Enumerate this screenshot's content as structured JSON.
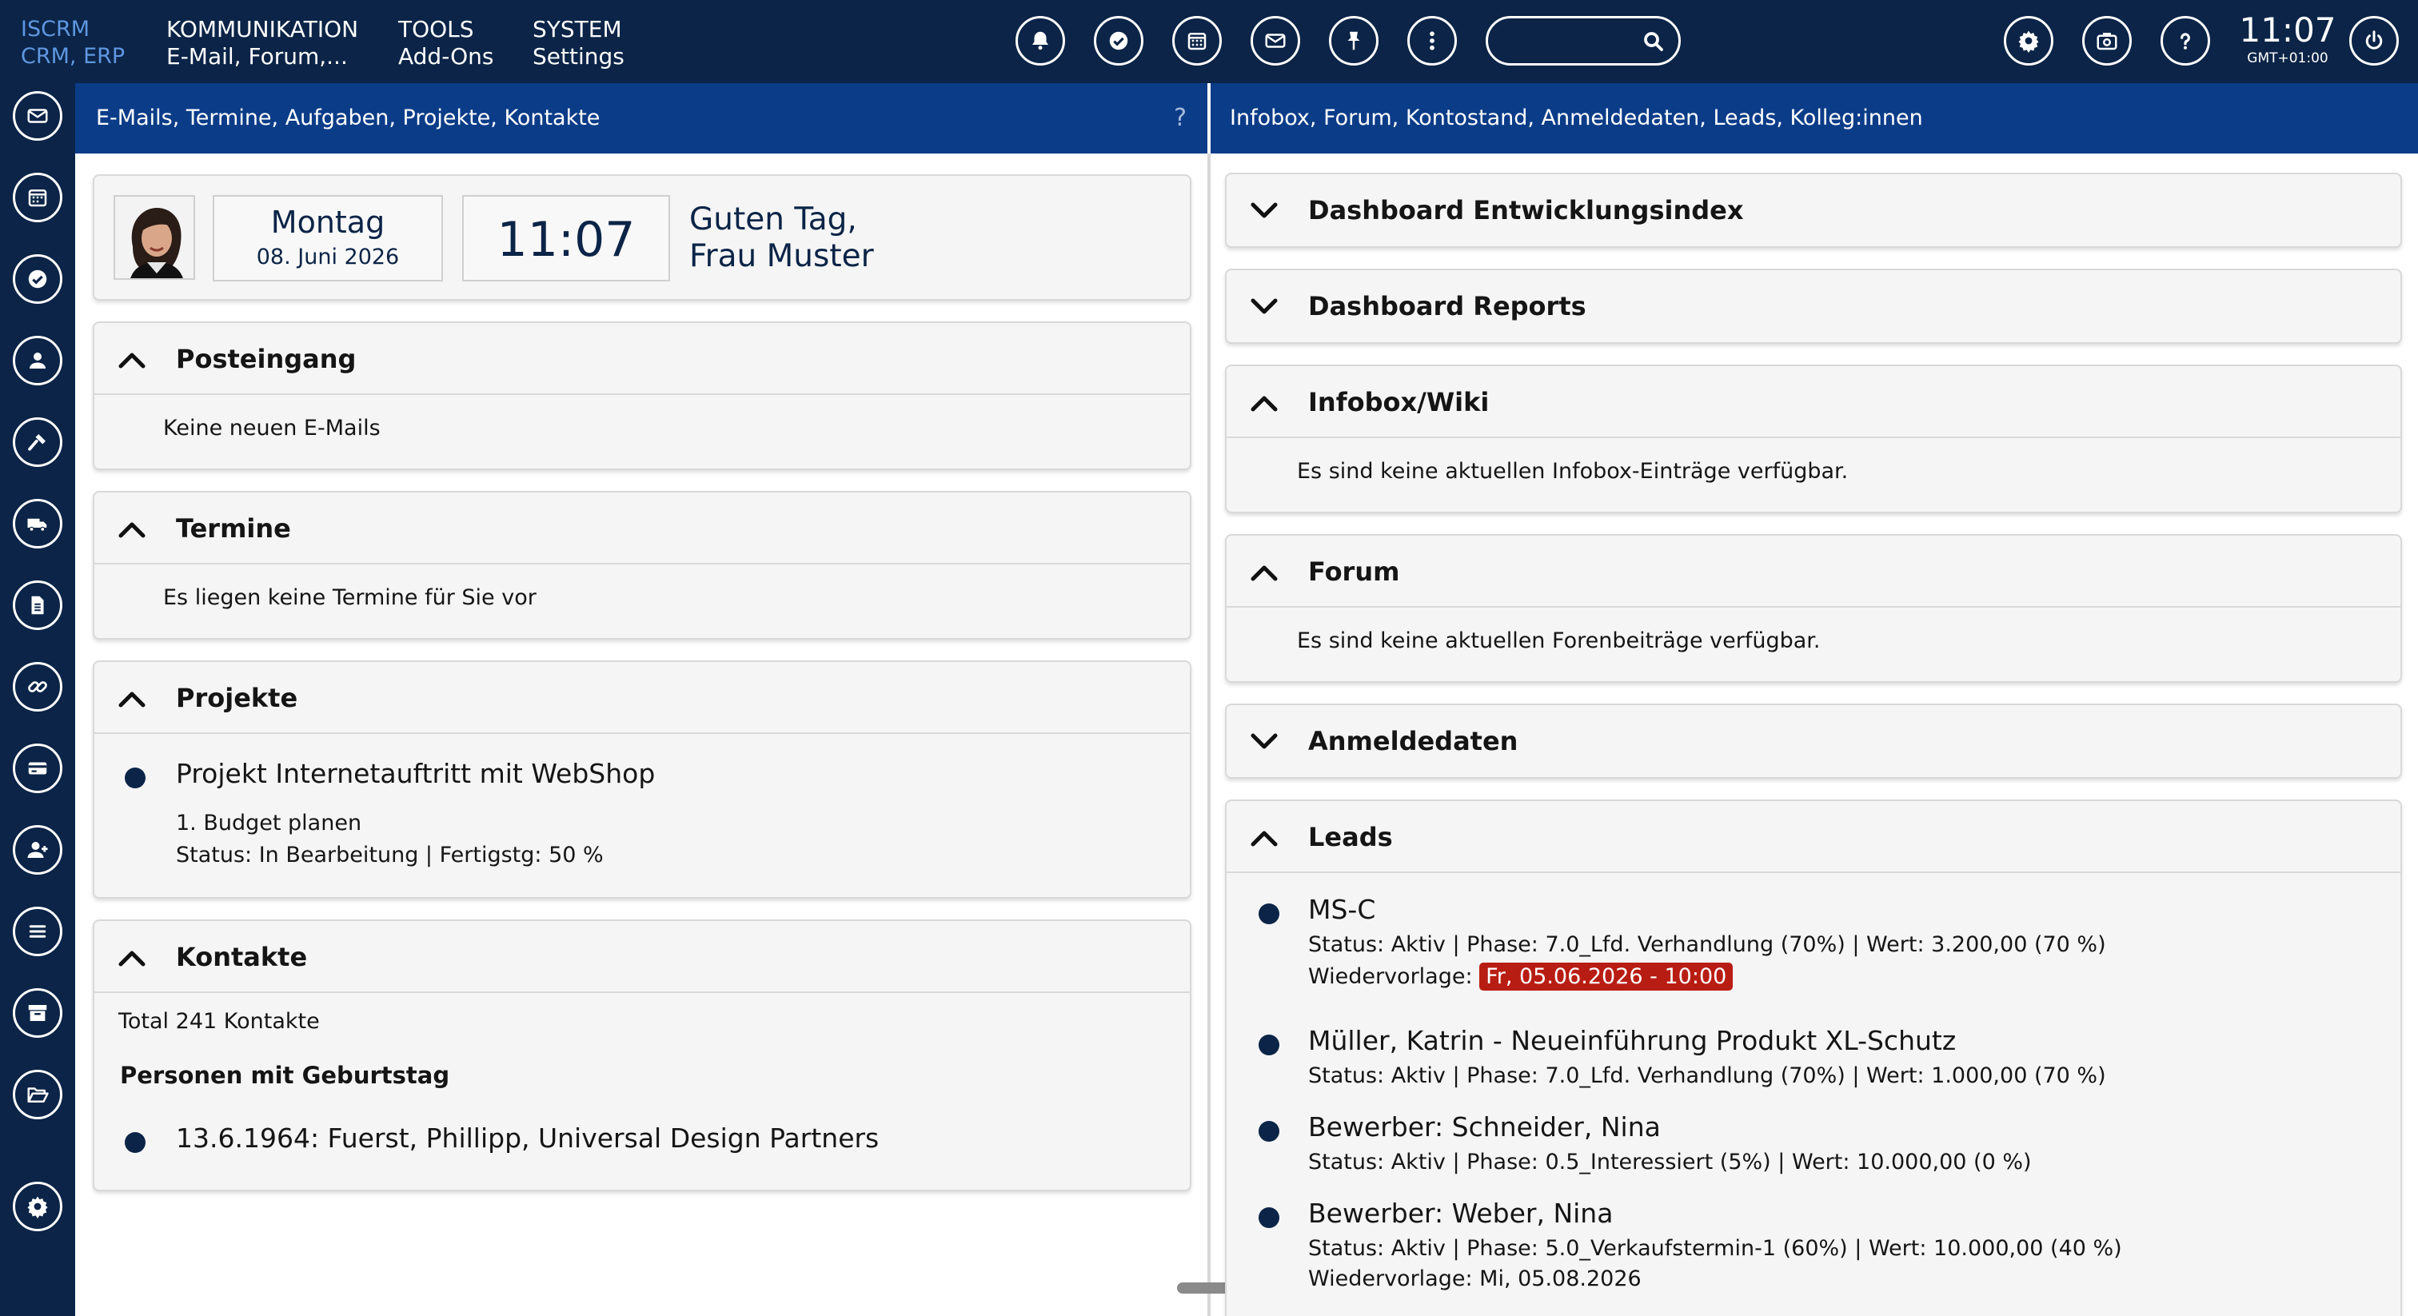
{
  "brand": {
    "line1": "ISCRM",
    "line2": "CRM, ERP"
  },
  "menu": [
    {
      "title": "KOMMUNIKATION",
      "sub": "E-Mail, Forum,..."
    },
    {
      "title": "TOOLS",
      "sub": "Add-Ons"
    },
    {
      "title": "SYSTEM",
      "sub": "Settings"
    }
  ],
  "top_icons": [
    "bell-icon",
    "check-circle-icon",
    "calendar-icon",
    "envelope-icon",
    "pin-icon",
    "more-vertical-icon",
    "gear-icon",
    "briefcase-icon",
    "question-icon",
    "power-icon"
  ],
  "search": {
    "placeholder": "",
    "value": ""
  },
  "clock": {
    "time": "11:07",
    "zone": "GMT+01:00"
  },
  "sidebar_icons": [
    "envelope-icon",
    "calendar-icon",
    "check-icon",
    "user-icon",
    "hammer-icon",
    "truck-icon",
    "document-icon",
    "link-icon",
    "credit-card-icon",
    "user-plus-icon",
    "list-icon",
    "archive-icon",
    "folder-open-icon",
    "gear-icon"
  ],
  "left_panel": {
    "header": "E-Mails, Termine, Aufgaben, Projekte, Kontakte",
    "help": "?",
    "greeting_card": {
      "weekday": "Montag",
      "date": "08. Juni 2026",
      "time": "11:07",
      "greeting_line1": "Guten Tag,",
      "greeting_line2": "Frau Muster"
    },
    "posteingang": {
      "title": "Posteingang",
      "text": "Keine neuen E-Mails"
    },
    "termine": {
      "title": "Termine",
      "text": "Es liegen keine Termine für Sie vor"
    },
    "projekte": {
      "title": "Projekte",
      "project_name": "Projekt Internetauftritt mit WebShop",
      "task": "1. Budget planen",
      "status": "Status: In Bearbeitung | Fertigstg: 50 %"
    },
    "kontakte": {
      "title": "Kontakte",
      "total": "Total 241 Kontakte",
      "birthday_heading": "Personen mit Geburtstag",
      "birthday_entry": "13.6.1964: Fuerst, Phillipp, Universal Design Partners"
    }
  },
  "right_panel": {
    "header": "Infobox, Forum, Kontostand, Anmeldedaten, Leads, Kolleg:innen",
    "entwicklungsindex": {
      "title": "Dashboard Entwicklungsindex"
    },
    "reports": {
      "title": "Dashboard Reports"
    },
    "infobox": {
      "title": "Infobox/Wiki",
      "text": "Es sind keine aktuellen Infobox-Einträge verfügbar."
    },
    "forum": {
      "title": "Forum",
      "text": "Es sind keine aktuellen Forenbeiträge verfügbar."
    },
    "anmeldedaten": {
      "title": "Anmeldedaten"
    },
    "leads": {
      "title": "Leads",
      "items": [
        {
          "name": "MS-C",
          "status": "Status: Aktiv | Phase: 7.0_Lfd. Verhandlung (70%) | Wert: 3.200,00 (70 %)",
          "followup_label": "Wiedervorlage:",
          "followup_value": "Fr, 05.06.2026 - 10:00",
          "overdue_color": "#b81d13"
        },
        {
          "name": "Müller, Katrin - Neueinführung Produkt XL-Schutz",
          "status": "Status: Aktiv | Phase: 7.0_Lfd. Verhandlung (70%) | Wert: 1.000,00 (70 %)"
        },
        {
          "name": "Bewerber: Schneider, Nina",
          "status": "Status: Aktiv | Phase: 0.5_Interessiert (5%) | Wert: 10.000,00 (0 %)"
        },
        {
          "name": "Bewerber: Weber, Nina",
          "status": "Status: Aktiv | Phase: 5.0_Verkaufstermin-1 (60%) | Wert: 10.000,00 (40 %)",
          "followup_label": "Wiedervorlage:",
          "followup_value": "Mi, 05.08.2026"
        }
      ]
    }
  },
  "colors": {
    "navy": "#0b2447",
    "header_blue": "#0b3c88",
    "brand_blue": "#5f97e0",
    "overdue_red": "#b81d13"
  }
}
